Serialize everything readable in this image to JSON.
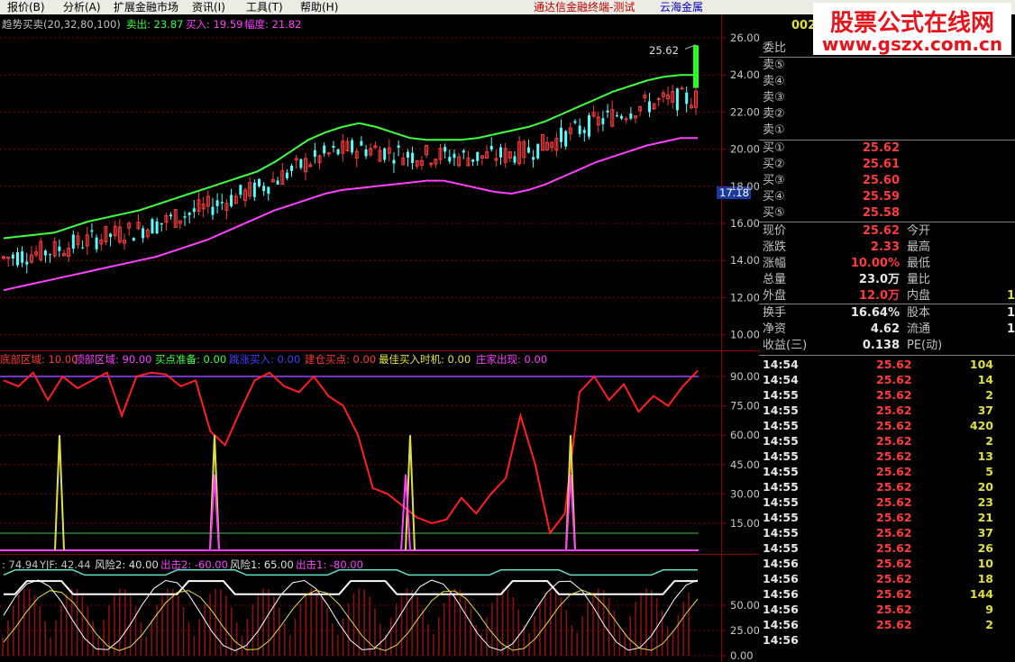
{
  "menu": {
    "items": [
      "报价(B)",
      "分析(A)",
      "扩展金融市场",
      "资讯(I)",
      "工具(T)",
      "帮助(H)"
    ],
    "app_title": "通达信金融终端-测试",
    "quote_title": "云海金属"
  },
  "main_panel": {
    "indicator_name": "趋势买卖(20,32,80,100)",
    "sell_label": "卖出: 23.87",
    "buy_label": "买入: 19.59",
    "range_label": "幅度: 21.82",
    "high_marker": "25.62",
    "price_marker": "17.18",
    "y_ticks": [
      "26.00",
      "24.00",
      "22.00",
      "20.00",
      "18.00",
      "16.00",
      "14.00",
      "12.00",
      "10.00"
    ]
  },
  "mid_panel": {
    "labels": [
      "底部区域: 10.00",
      "顶部区域: 90.00",
      "买点准备: 0.00",
      "跳涨买入: 0.00",
      "建仓买点: 0.00",
      "最佳买入时机: 0.00",
      "庄家出现: 0.00"
    ],
    "y_ticks": [
      "90.00",
      "75.00",
      "60.00",
      "45.00",
      "30.00",
      "15.00"
    ]
  },
  "bottom_panel": {
    "labels": [
      ": 74.94",
      "YJF: 42.44",
      "风险2: 40.00",
      "出击2: -60.00",
      "风险1: 65.00",
      "出击1: -80.00"
    ],
    "y_ticks": [
      "50.00",
      "25.00",
      "0.00"
    ]
  },
  "side": {
    "code": "002",
    "weibi_label": "委比",
    "sell_levels": [
      "卖⑤",
      "卖④",
      "卖③",
      "卖②",
      "卖①"
    ],
    "buy_levels": [
      {
        "label": "买①",
        "price": "25.62"
      },
      {
        "label": "买②",
        "price": "25.61"
      },
      {
        "label": "买③",
        "price": "25.60"
      },
      {
        "label": "买④",
        "price": "25.59"
      },
      {
        "label": "买⑤",
        "price": "25.58"
      }
    ],
    "stats": [
      {
        "l": "现价",
        "v": "25.62",
        "l2": "今开",
        "v2": ""
      },
      {
        "l": "涨跌",
        "v": "2.33",
        "l2": "最高",
        "v2": ""
      },
      {
        "l": "涨幅",
        "v": "10.00%",
        "l2": "最低",
        "v2": ""
      },
      {
        "l": "总量",
        "v": "23.0万",
        "l2": "量比",
        "v2": ""
      },
      {
        "l": "外盘",
        "v": "12.0万",
        "l2": "内盘",
        "v2": "1"
      }
    ],
    "stats2": [
      {
        "l": "换手",
        "v": "16.64%",
        "l2": "股本",
        "v2": "1"
      },
      {
        "l": "净资",
        "v": "4.62",
        "l2": "流通",
        "v2": "1"
      },
      {
        "l": "收益(三)",
        "v": "0.138",
        "l2": "PE(动)",
        "v2": ""
      }
    ],
    "ticks": [
      {
        "t": "14:54",
        "p": "25.62",
        "q": "104"
      },
      {
        "t": "14:54",
        "p": "25.62",
        "q": "14"
      },
      {
        "t": "14:55",
        "p": "25.62",
        "q": "2"
      },
      {
        "t": "14:55",
        "p": "25.62",
        "q": "37"
      },
      {
        "t": "14:55",
        "p": "25.62",
        "q": "420"
      },
      {
        "t": "14:55",
        "p": "25.62",
        "q": "2"
      },
      {
        "t": "14:55",
        "p": "25.62",
        "q": "13"
      },
      {
        "t": "14:55",
        "p": "25.62",
        "q": "5"
      },
      {
        "t": "14:55",
        "p": "25.62",
        "q": "20"
      },
      {
        "t": "14:55",
        "p": "25.62",
        "q": "23"
      },
      {
        "t": "14:55",
        "p": "25.62",
        "q": "21"
      },
      {
        "t": "14:55",
        "p": "25.62",
        "q": "37"
      },
      {
        "t": "14:55",
        "p": "25.62",
        "q": "26"
      },
      {
        "t": "14:56",
        "p": "25.62",
        "q": "10"
      },
      {
        "t": "14:56",
        "p": "25.62",
        "q": "18"
      },
      {
        "t": "14:56",
        "p": "25.62",
        "q": "144"
      },
      {
        "t": "14:56",
        "p": "25.62",
        "q": "9"
      },
      {
        "t": "14:56",
        "p": "25.62",
        "q": "2"
      },
      {
        "t": "14:56",
        "p": "",
        "q": ""
      }
    ]
  },
  "watermark": {
    "line1": "股票公式在线网",
    "line2": "www.gszx.com.cn"
  },
  "colors": {
    "up": "#ff3c3c",
    "down": "#54ffff",
    "band_upper": "#40ff40",
    "band_lower": "#ff40ff",
    "grid": "#8b0000"
  },
  "chart_data": {
    "type": "candlestick",
    "price_axis": [
      10,
      26
    ],
    "band_upper": [
      15.2,
      15.3,
      15.4,
      15.5,
      15.8,
      16.1,
      16.3,
      16.5,
      16.7,
      17.0,
      17.3,
      17.6,
      17.9,
      18.2,
      18.5,
      18.8,
      19.3,
      19.9,
      20.5,
      20.9,
      21.2,
      21.4,
      21.2,
      20.9,
      20.6,
      20.5,
      20.5,
      20.5,
      20.6,
      20.8,
      21.0,
      21.2,
      21.5,
      21.9,
      22.3,
      22.7,
      23.1,
      23.4,
      23.7,
      23.9,
      24.0,
      24.0
    ],
    "band_lower": [
      12.4,
      12.6,
      12.8,
      13.0,
      13.2,
      13.4,
      13.6,
      13.8,
      14.0,
      14.2,
      14.5,
      14.8,
      15.1,
      15.5,
      15.9,
      16.3,
      16.7,
      17.0,
      17.3,
      17.6,
      17.8,
      17.9,
      18.0,
      18.1,
      18.2,
      18.3,
      18.3,
      18.1,
      17.9,
      17.7,
      17.6,
      17.8,
      18.1,
      18.5,
      18.9,
      19.3,
      19.6,
      19.9,
      20.2,
      20.4,
      20.6,
      20.6
    ]
  }
}
